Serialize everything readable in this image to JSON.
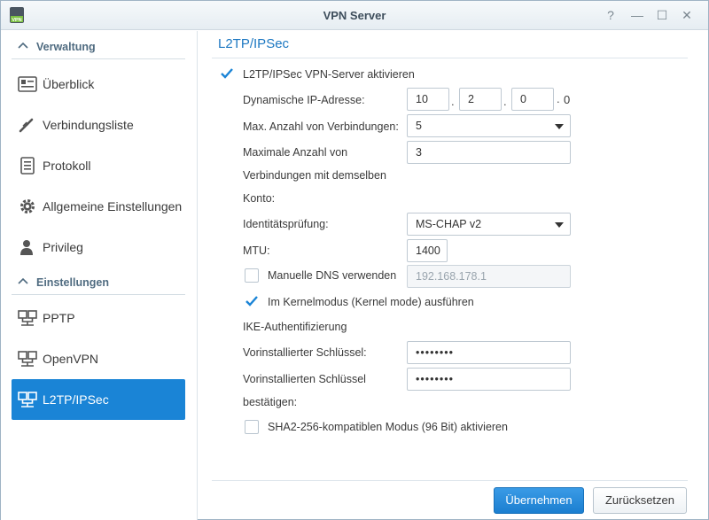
{
  "window": {
    "title": "VPN Server",
    "app_icon_text": "VPN",
    "help_glyph": "?",
    "minimize_glyph": "—",
    "maximize_glyph": "☐",
    "close_glyph": "✕"
  },
  "sidebar": {
    "section1": "Verwaltung",
    "section2": "Einstellungen",
    "items": [
      {
        "label": "Überblick",
        "icon": "overview-icon"
      },
      {
        "label": "Verbindungsliste",
        "icon": "connection-list-icon"
      },
      {
        "label": "Protokoll",
        "icon": "log-icon"
      },
      {
        "label": "Allgemeine Einstellungen",
        "icon": "gear-icon"
      },
      {
        "label": "Privileg",
        "icon": "user-icon"
      },
      {
        "label": "PPTP",
        "icon": "network-icon"
      },
      {
        "label": "OpenVPN",
        "icon": "network-icon"
      },
      {
        "label": "L2TP/IPSec",
        "icon": "network-icon",
        "active": true
      }
    ]
  },
  "main": {
    "title": "L2TP/IPSec",
    "enable_label": "L2TP/IPSec VPN-Server aktivieren",
    "enable_checked": true,
    "dyn_ip_label": "Dynamische IP-Adresse:",
    "ip": [
      "10",
      "2",
      "0",
      "0"
    ],
    "ip_sep": ".",
    "max_conn_label": "Max. Anzahl von Verbindungen:",
    "max_conn_value": "5",
    "max_same_label_1": "Maximale Anzahl von",
    "max_same_label_2": "Verbindungen mit demselben",
    "max_same_label_3": "Konto:",
    "max_same_value": "3",
    "auth_label": "Identitätsprüfung:",
    "auth_value": "MS-CHAP v2",
    "mtu_label": "MTU:",
    "mtu_value": "1400",
    "manual_dns_label": "Manuelle DNS verwenden",
    "manual_dns_checked": false,
    "manual_dns_value": "192.168.178.1",
    "kernel_label": "Im Kernelmodus (Kernel mode) ausführen",
    "kernel_checked": true,
    "ike_header": "IKE-Authentifizierung",
    "psk_label": "Vorinstallierter Schlüssel:",
    "psk_value": "••••••••",
    "psk_confirm_label_1": "Vorinstallierten Schlüssel",
    "psk_confirm_label_2": "bestätigen:",
    "psk_confirm_value": "••••••••",
    "sha2_label": "SHA2-256-kompatiblen Modus (96 Bit) aktivieren",
    "sha2_checked": false
  },
  "footer": {
    "apply_label": "Übernehmen",
    "reset_label": "Zurücksetzen"
  },
  "colors": {
    "accent": "#1a84d6",
    "check": "#1a84d6"
  }
}
